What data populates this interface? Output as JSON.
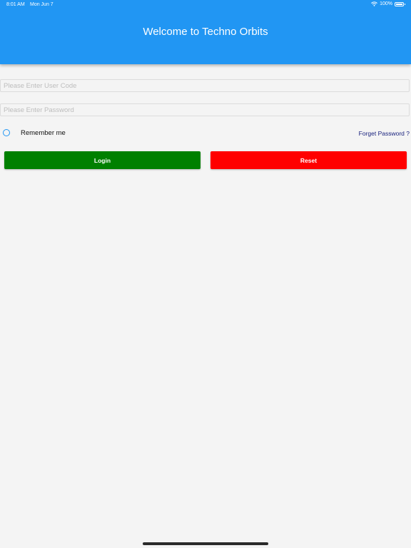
{
  "status_bar": {
    "time": "8:01 AM",
    "date": "Mon Jun 7",
    "battery": "100%",
    "wifi_icon": "wifi-icon",
    "battery_icon": "battery-icon"
  },
  "header": {
    "title": "Welcome to Techno Orbits",
    "background_color": "#2196f3"
  },
  "form": {
    "user_code_placeholder": "Please Enter User Code",
    "user_code_value": "",
    "password_placeholder": "Please Enter Password",
    "password_value": "",
    "remember_label": "Remember me",
    "remember_checked": false,
    "forgot_label": "Forget Password ?"
  },
  "buttons": {
    "login_label": "Login",
    "login_color": "#008000",
    "reset_label": "Reset",
    "reset_color": "#ff0000"
  }
}
